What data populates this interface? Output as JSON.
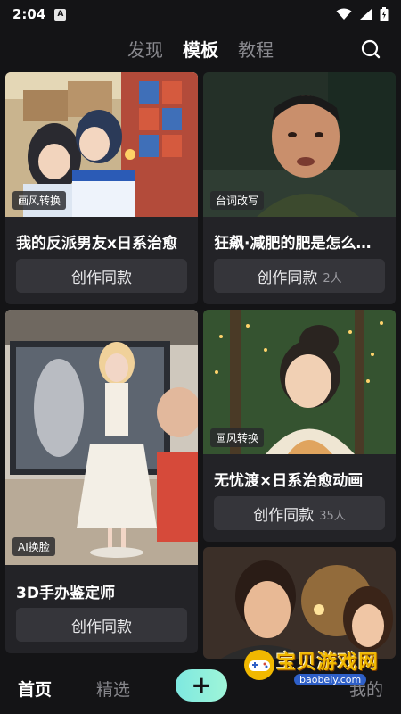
{
  "status_bar": {
    "time": "2:04",
    "app_badge": "A"
  },
  "top_tabs": [
    {
      "label": "发现",
      "active": false
    },
    {
      "label": "模板",
      "active": true
    },
    {
      "label": "教程",
      "active": false
    }
  ],
  "cards": [
    {
      "tag": "画风转换",
      "title": "我的反派男友x日系治愈",
      "button": "创作同款",
      "count": ""
    },
    {
      "tag": "台词改写",
      "title": "狂飙·减肥的肥是怎么…",
      "button": "创作同款",
      "count": "2人"
    },
    {
      "tag": "AI换脸",
      "title": "3D手办鉴定师",
      "button": "创作同款",
      "count": ""
    },
    {
      "tag": "画风转换",
      "title": "无忧渡×日系治愈动画",
      "button": "创作同款",
      "count": "35人"
    }
  ],
  "bottom_nav": {
    "home": "首页",
    "featured": "精选",
    "mine": "我的",
    "add_symbol": "+"
  },
  "watermark": {
    "title": "宝贝游戏网",
    "url": "baobeiy.com"
  },
  "colors": {
    "background": "#141416",
    "card": "#232327",
    "button": "#35353a",
    "accent": "#8ef0dc"
  }
}
